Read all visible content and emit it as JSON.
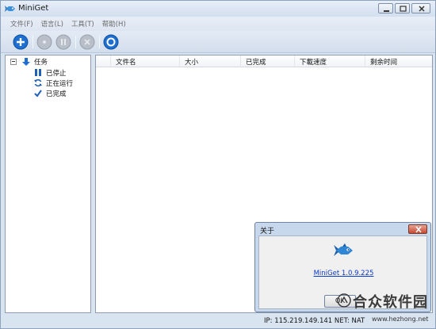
{
  "window": {
    "title": "MiniGet"
  },
  "menu": {
    "items": [
      "文件(F)",
      "语言(L)",
      "工具(T)",
      "帮助(H)"
    ]
  },
  "toolbar": {
    "buttons": [
      "add-icon",
      "stop-icon",
      "pause-icon",
      "delete-icon",
      "settings-icon"
    ]
  },
  "sidebar": {
    "root": "任务",
    "items": [
      "已停止",
      "正在运行",
      "已完成"
    ]
  },
  "list": {
    "columns": [
      "文件名",
      "大小",
      "已完成",
      "下載速度",
      "剩余时间"
    ]
  },
  "status": {
    "text": "IP: 115.219.149.141 NET: NAT"
  },
  "dialog": {
    "title": "关于",
    "link": "MiniGet 1.0.9.225",
    "ok": "OK"
  },
  "watermark": {
    "brand": "合众软件园",
    "url": "www.hezhong.net"
  },
  "colors": {
    "accent": "#1e6fd0",
    "link": "#0a38c8",
    "close": "#c84a33"
  }
}
